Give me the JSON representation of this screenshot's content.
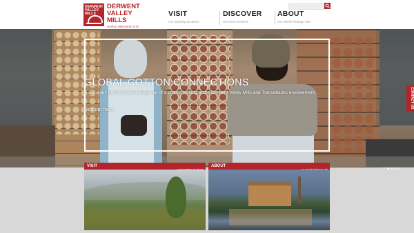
{
  "logo": {
    "mark_text": "DERWENT VALLEY MILLS",
    "name_line1": "DERWENT",
    "name_line2": "VALLEY",
    "name_line3": "MILLS",
    "tagline": "WORLD HERITAGE SITE"
  },
  "nav": [
    {
      "label": "VISIT",
      "sub": "Our inspiring locations"
    },
    {
      "label": "DISCOVER",
      "sub": "Get more involved"
    },
    {
      "label": "ABOUT",
      "sub": "Our World Heritage Site"
    }
  ],
  "search": {
    "placeholder": ""
  },
  "hero": {
    "title": "GLOBAL COTTON CONNECTIONS",
    "description": "A summary by Dr Susanne Seymour of a project looking at the Derwent Valley Mills and Transatlantic enslavement.",
    "link": "Find out more"
  },
  "contact_tab": "CONTACT US",
  "carousel": {
    "count": 4,
    "active": 0
  },
  "cards": [
    {
      "title": "VISIT",
      "sub": "our inspiring locations"
    },
    {
      "title": "ABOUT",
      "sub": "our world heritage site"
    }
  ],
  "colors": {
    "brand": "#b2252a"
  }
}
